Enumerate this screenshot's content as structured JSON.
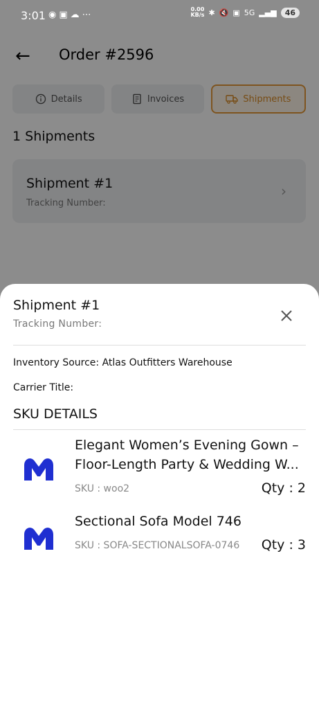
{
  "status_bar": {
    "time": "3:01",
    "left_icons": [
      "chat-icon",
      "instagram-icon",
      "cloud-icon",
      "more-icon"
    ],
    "net_speed": "0.00",
    "net_unit": "KB/s",
    "battery": "46",
    "network": "5G"
  },
  "header": {
    "title": "Order #2596"
  },
  "tabs": [
    {
      "label": "Details",
      "icon": "info-icon"
    },
    {
      "label": "Invoices",
      "icon": "receipt-icon"
    },
    {
      "label": "Shipments",
      "icon": "truck-icon",
      "active": true
    }
  ],
  "shipments_count_label": "1 Shipments",
  "shipment_card": {
    "title": "Shipment #1",
    "tracking_label": "Tracking Number:"
  },
  "sheet": {
    "title": "Shipment #1",
    "tracking_label": "Tracking Number:",
    "inventory_source": "Inventory Source: Atlas Outfitters Warehouse",
    "carrier_title": "Carrier Title:",
    "sku_heading": "SKU DETAILS",
    "items": [
      {
        "name_line1": "Elegant Women’s Evening Gown –",
        "name_line2": "Floor-Length Party & Wedding W...",
        "sku": "SKU : woo2",
        "qty": "Qty : 2"
      },
      {
        "name_line1": "Sectional Sofa Model 746",
        "sku": "SKU : SOFA-SECTIONALSOFA-0746",
        "qty": "Qty : 3"
      }
    ]
  },
  "colors": {
    "accent": "#e59a3a",
    "logo_blue": "#1f2fd1",
    "scrim": "rgba(0,0,0,0.45)"
  }
}
